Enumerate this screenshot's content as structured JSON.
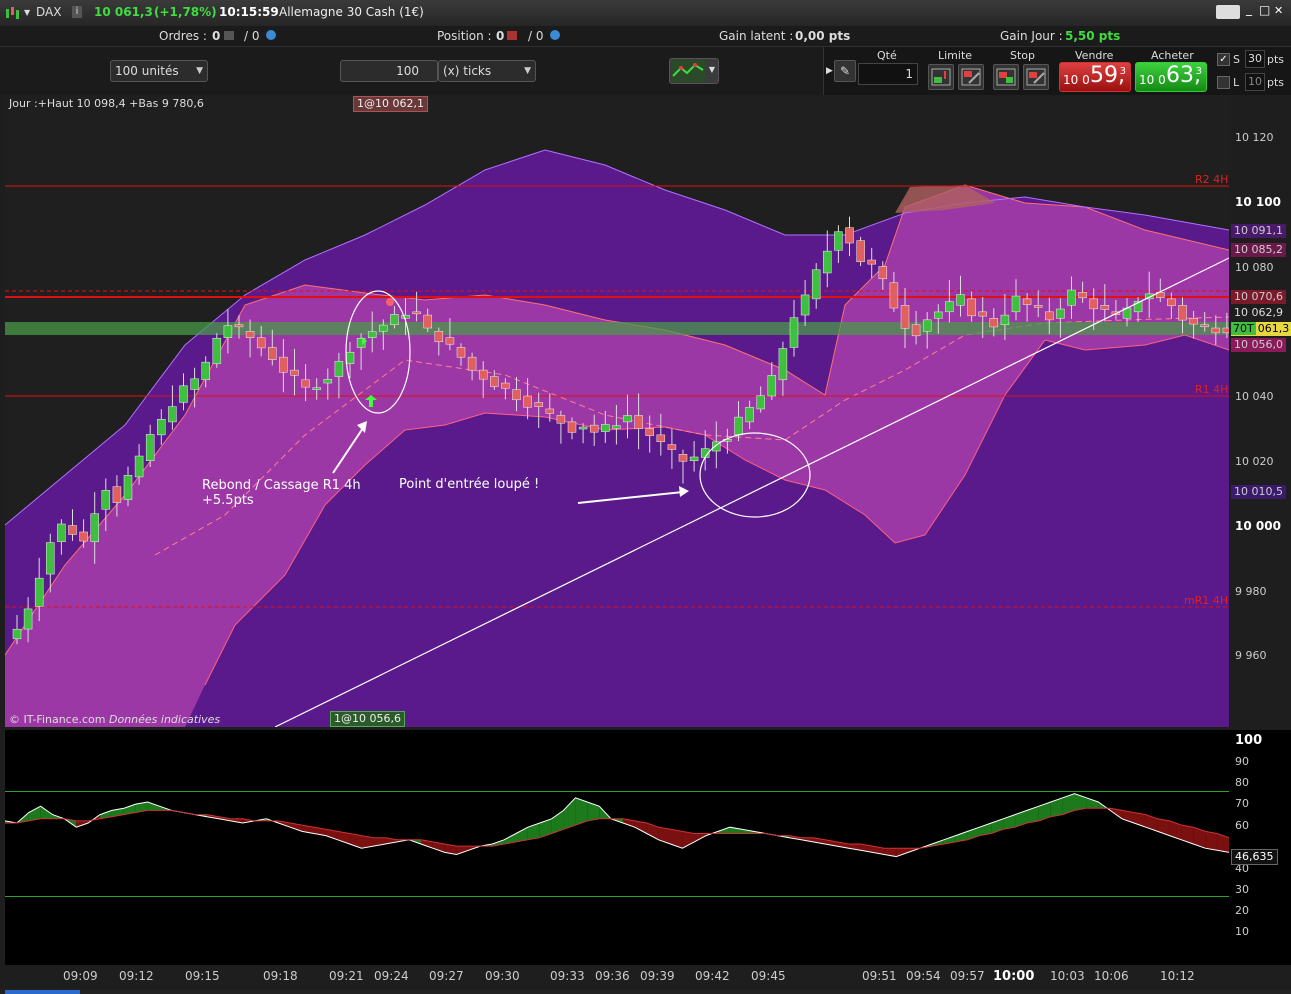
{
  "titlebar": {
    "symbol": "DAX",
    "price": "10 061,3",
    "change": "(+1,78%)",
    "time": "10:15:59",
    "instrument": "Allemagne 30 Cash (1€)",
    "btn_minimize": "_",
    "btn_maximize": "□",
    "btn_close": "✕",
    "keyboard_icon": "keyboard-icon"
  },
  "infobar": {
    "orders_label": "Ordres :",
    "orders_a": "0",
    "orders_b": "/ 0",
    "position_label": "Position :",
    "position_a": "0",
    "position_b": "/ 0",
    "gain_latent_label": "Gain latent :",
    "gain_latent_value": "0,00 pts",
    "gain_jour_label": "Gain Jour :",
    "gain_jour_value": "5,50 pts"
  },
  "toolbar": {
    "units_value": "100 unités",
    "ticks_qty": "100",
    "ticks_unit": "(x) ticks",
    "qte_label": "Qté",
    "qte_value": "1",
    "limite_label": "Limite",
    "stop_label": "Stop",
    "vendre_label": "Vendre",
    "acheter_label": "Acheter",
    "vendre_prefix": "10 0",
    "vendre_big": "59,",
    "vendre_sup": "3",
    "acheter_prefix": "10 0",
    "acheter_big": "63,",
    "acheter_sup": "3",
    "s_label": "S",
    "s_value": "30",
    "s_unit": "pts",
    "l_label": "L",
    "l_value": "10",
    "l_unit": "pts"
  },
  "chart": {
    "header": "Jour :+Haut 10 098,4 +Bas 9 780,6",
    "order_tag_top": "1@10 062,1",
    "order_tag_bottom": "1@10 056,6",
    "copyright": "© IT-Finance.com",
    "copyright_note": "Données indicatives",
    "annotation1_line1": "Rebond / Cassage R1 4h",
    "annotation1_line2": "+5.5pts",
    "annotation2": "Point d'entrée loupé !",
    "level_r2": "R2 4H",
    "level_r1": "R1 4H",
    "level_mr1": "mR1 4H",
    "colors": {
      "up": "#3fbf3f",
      "down": "#e06060",
      "band_outer": "#5a1a8c",
      "band_inner": "#a23aa8",
      "level": "#e01010"
    }
  },
  "price_axis": {
    "ticks": [
      "10 120",
      "10 100",
      "10 080",
      "10 040",
      "10 020",
      "10 000",
      "9 980",
      "9 960"
    ],
    "tag_091": "10 091,1",
    "tag_085": "10 085,2",
    "tag_070": "10 070,6",
    "tag_062": "10 062,9",
    "tag_061": "061,3",
    "tag_061_prefix": "70T",
    "tag_056": "10 056,0",
    "tag_010": "10 010,5"
  },
  "osc_axis": {
    "ticks": [
      "100",
      "90",
      "80",
      "70",
      "60",
      "40",
      "30",
      "20",
      "10"
    ],
    "value_tag": "46,635"
  },
  "time_axis": {
    "ticks": [
      "09:09",
      "09:12",
      "09:15",
      "09:18",
      "09:21",
      "09:24",
      "09:27",
      "09:30",
      "09:33",
      "09:36",
      "09:39",
      "09:42",
      "09:45",
      "09:51",
      "09:54",
      "09:57",
      "10:00",
      "10:03",
      "10:06",
      "10:12"
    ]
  }
}
